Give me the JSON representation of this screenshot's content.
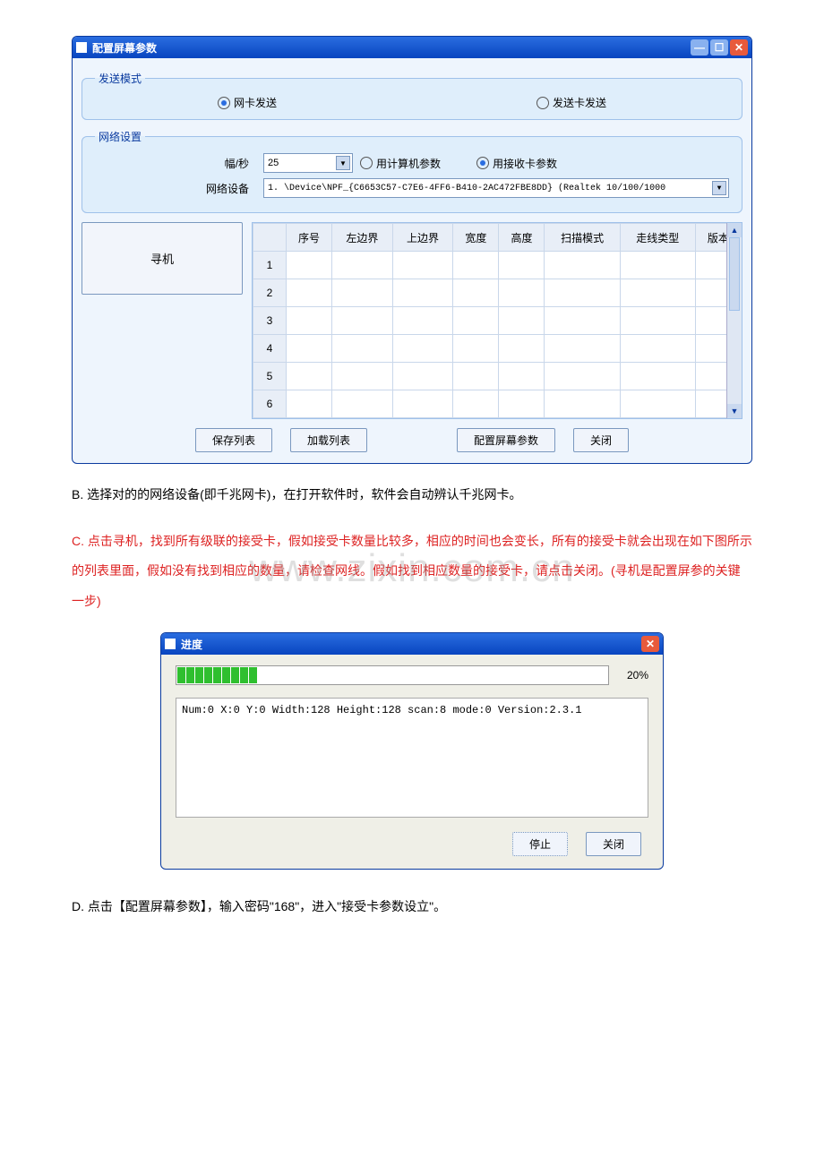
{
  "win1": {
    "title": "配置屏幕参数",
    "send_mode": {
      "legend": "发送模式",
      "opt1": "网卡发送",
      "opt2": "发送卡发送",
      "selected": 1
    },
    "net": {
      "legend": "网络设置",
      "fps_label": "幅/秒",
      "fps_value": "25",
      "radio1": "用计算机参数",
      "radio2": "用接收卡参数",
      "radio_selected": 2,
      "dev_label": "网络设备",
      "dev_value": "1. \\Device\\NPF_{C6653C57-C7E6-4FF6-B410-2AC472FBE8DD} (Realtek 10/100/1000"
    },
    "seek_label": "寻机",
    "table_headers": [
      "序号",
      "左边界",
      "上边界",
      "宽度",
      "高度",
      "扫描模式",
      "走线类型",
      "版本"
    ],
    "row_nums": [
      "1",
      "2",
      "3",
      "4",
      "5",
      "6"
    ],
    "buttons": {
      "save": "保存列表",
      "load": "加载列表",
      "config": "配置屏幕参数",
      "close": "关闭"
    }
  },
  "para_b": "B. 选择对的的网络设备(即千兆网卡)，在打开软件时，软件会自动辨认千兆网卡。",
  "para_c": "C. 点击寻机，找到所有级联的接受卡，假如接受卡数量比较多，相应的时间也会变长，所有的接受卡就会出现在如下图所示的列表里面，假如没有找到相应的数量，请检查网线。假如找到相应数量的接受卡，请点击关闭。(寻机是配置屏参的关键一步)",
  "win2": {
    "title": "进度",
    "percent": "20%",
    "log_text": "Num:0 X:0 Y:0 Width:128 Height:128 scan:8 mode:0 Version:2.3.1",
    "stop": "停止",
    "close": "关闭"
  },
  "para_d": "D. 点击【配置屏幕参数】，输入密码\"168\"，进入\"接受卡参数设立\"。",
  "watermark": "www.zixin.com.cn"
}
